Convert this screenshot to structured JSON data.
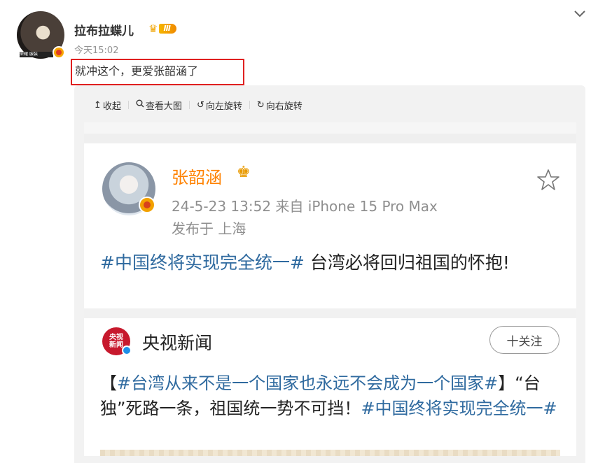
{
  "post": {
    "username": "拉布拉蝶儿",
    "vip_level": "Ⅲ",
    "time": "今天15:02",
    "text": "就冲这个，更爱张韶涵了",
    "avatar_caption": "荣耀 服装"
  },
  "viewer_toolbar": {
    "collapse": "收起",
    "view_large": "查看大图",
    "rotate_left": "向左旋转",
    "rotate_right": "向右旋转"
  },
  "embedded": {
    "author": "张韶涵",
    "meta": "24-5-23 13:52  来自 iPhone 15 Pro Max",
    "location": "发布于 上海",
    "hashtag": "#中国终将实现完全统一#",
    "text": " 台湾必将回归祖国的怀抱!",
    "repost": {
      "account_name": "央视新闻",
      "logo_line1": "央视",
      "logo_line2": "新闻",
      "follow_label": "十关注",
      "text_open_bracket": "【",
      "hashtag1": "#台湾从来不是一个国家也永远不会成为一个国家#",
      "text_mid": "】“台独”死路一条，祖国统一势不可挡！",
      "hashtag2": "#中国终将实现完全统一#"
    }
  },
  "colors": {
    "accent_orange": "#ff8200",
    "hashtag_blue": "#2f6a9f",
    "highlight_red": "#e02020"
  },
  "icons": {
    "menu": "chevron-down-icon",
    "collapse": "arrow-up-icon",
    "view_large": "search-icon",
    "rotate_left": "rotate-left-icon",
    "rotate_right": "rotate-right-icon",
    "favorite": "star-icon"
  }
}
